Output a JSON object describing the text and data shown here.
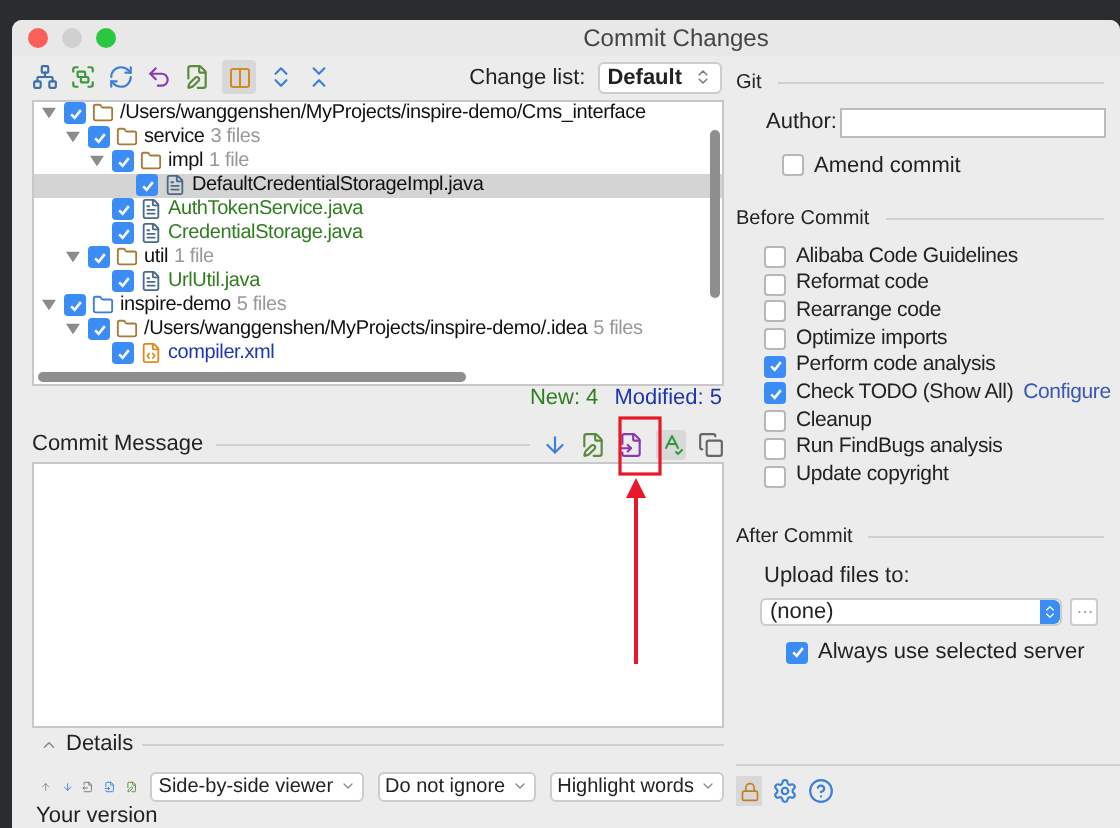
{
  "window": {
    "title": "Commit Changes"
  },
  "toolbar": {
    "change_list_label": "Change list:",
    "change_list_value": "Default"
  },
  "tree": [
    {
      "kind": "folder",
      "name": "/Users/wanggenshen/MyProjects/inspire-demo/Cms_interface",
      "checked": true,
      "selected": false,
      "expanded": true,
      "children": [
        {
          "kind": "folder",
          "name": "service",
          "count": "3 files",
          "checked": true,
          "selected": false,
          "expanded": true,
          "children": [
            {
              "kind": "folder",
              "name": "impl",
              "count": "1 file",
              "checked": true,
              "selected": false,
              "expanded": true,
              "children": [
                {
                  "kind": "java",
                  "name": "DefaultCredentialStorageImpl.java",
                  "color": "#111111",
                  "checked": true,
                  "selected": true
                }
              ]
            },
            {
              "kind": "java",
              "name": "AuthTokenService.java",
              "color": "#2e7d1f",
              "checked": true,
              "selected": false
            },
            {
              "kind": "java",
              "name": "CredentialStorage.java",
              "color": "#2e7d1f",
              "checked": true,
              "selected": false
            }
          ]
        },
        {
          "kind": "folder",
          "name": "util",
          "count": "1 file",
          "checked": true,
          "selected": false,
          "expanded": true,
          "children": [
            {
              "kind": "java",
              "name": "UrlUtil.java",
              "color": "#2e7d1f",
              "checked": true,
              "selected": false
            }
          ]
        }
      ]
    },
    {
      "kind": "module",
      "name": "inspire-demo",
      "count": "5 files",
      "checked": true,
      "selected": false,
      "expanded": true,
      "children": [
        {
          "kind": "folder",
          "name": "/Users/wanggenshen/MyProjects/inspire-demo/.idea",
          "count": "5 files",
          "checked": true,
          "selected": false,
          "expanded": true,
          "children": [
            {
              "kind": "xml",
              "name": "compiler.xml",
              "color": "#1f35b0",
              "checked": true,
              "selected": false
            }
          ]
        }
      ]
    }
  ],
  "summary": {
    "new": "New: 4",
    "modified": "Modified: 5"
  },
  "commit_message": {
    "label": "Commit Message"
  },
  "details": {
    "label": "Details"
  },
  "diff_toolbar": {
    "dropdowns": [
      "Side-by-side viewer",
      "Do not ignore",
      "Highlight words"
    ]
  },
  "your_version": "Your version",
  "git": {
    "title": "Git",
    "author_label": "Author:",
    "amend": {
      "label": "Amend commit",
      "checked": false
    }
  },
  "before_commit": {
    "title": "Before Commit",
    "options": [
      {
        "label": "Alibaba Code Guidelines",
        "checked": false
      },
      {
        "label": "Reformat code",
        "checked": false
      },
      {
        "label": "Rearrange code",
        "checked": false
      },
      {
        "label": "Optimize imports",
        "checked": false
      },
      {
        "label": "Perform code analysis",
        "checked": true
      },
      {
        "label": "Check TODO (Show All)",
        "checked": true,
        "link": "Configure"
      },
      {
        "label": "Cleanup",
        "checked": false
      },
      {
        "label": "Run FindBugs analysis",
        "checked": false
      },
      {
        "label": "Update copyright",
        "checked": false
      }
    ]
  },
  "after_commit": {
    "title": "After Commit",
    "upload_label": "Upload files to:",
    "upload_value": "(none)",
    "always": {
      "label": "Always use selected server",
      "checked": true
    }
  }
}
